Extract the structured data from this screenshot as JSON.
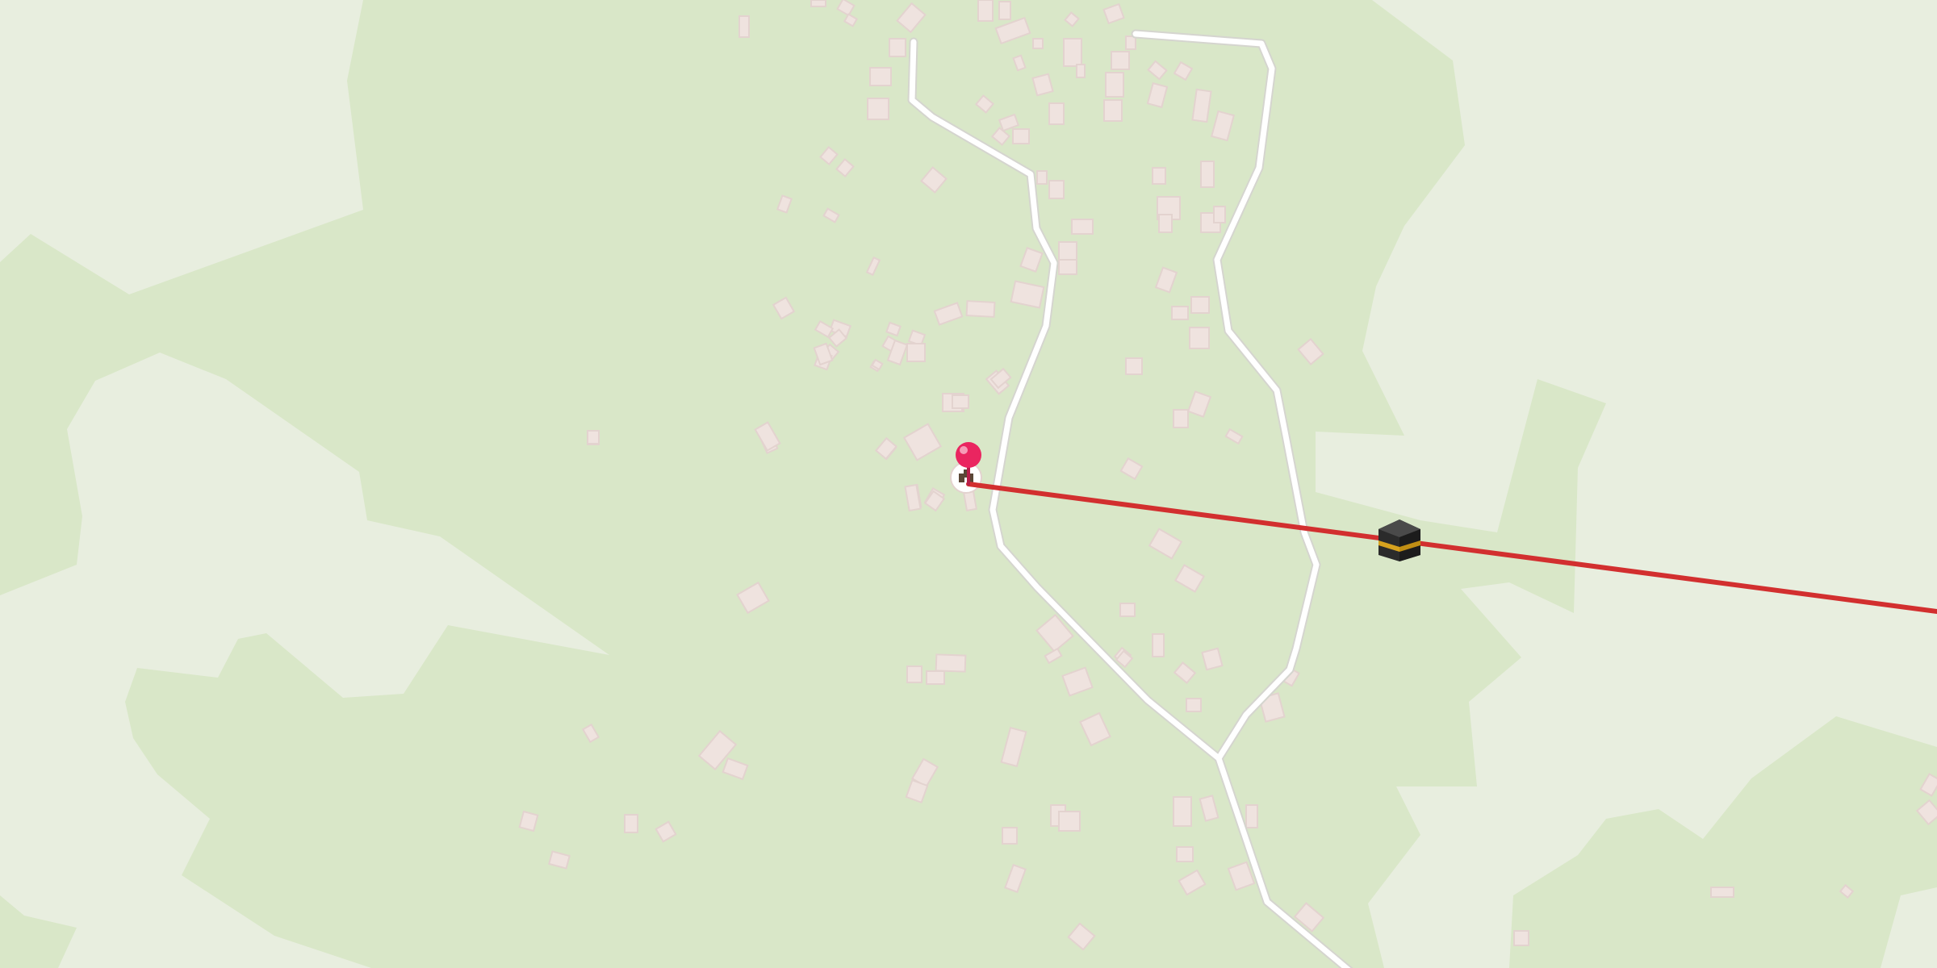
{
  "map": {
    "colors": {
      "background": "#e8eedf",
      "vegetation": "#d9e7c8",
      "building_fill": "#efe3df",
      "building_stroke": "#e3d3cf",
      "road": "#ffffff",
      "road_casing": "#d5d5cf",
      "qibla_line": "#d22f2f",
      "pin_head": "#ea2560",
      "pin_stem": "#b81e4a"
    },
    "layers": {
      "vegetation": "vegetation-areas",
      "buildings": "building-footprints",
      "roads": "road-network",
      "qibla_line": "qibla-direction-line"
    },
    "markers": {
      "location_pin": "map-pin-icon",
      "mosque": "mosque-icon",
      "kaaba": "kaaba-icon"
    }
  }
}
